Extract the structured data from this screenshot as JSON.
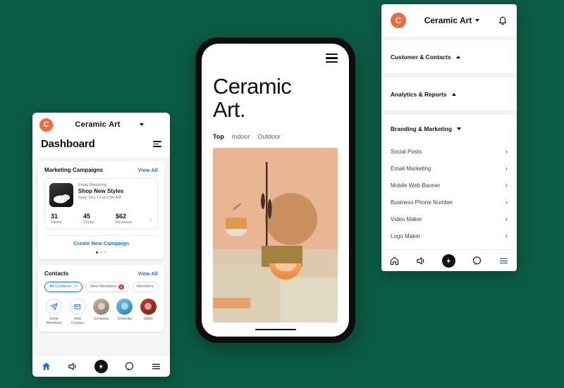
{
  "theme": {
    "background": "#0b5c46",
    "brand_orange": "#f2693c",
    "link_blue": "#1a73e8",
    "badge_red": "#e5342a",
    "dark": "#111111"
  },
  "left_phone": {
    "header": {
      "logo_letter": "C",
      "brand": "Ceramic Art",
      "chevron_icon": "chevron-down-icon"
    },
    "page_title": "Dashboard",
    "filter_icon": "list-filter-icon",
    "campaigns_card": {
      "title": "Marketing Campaigns",
      "view_all": "View All",
      "campaign": {
        "kind": "Email Marketing",
        "name": "Shop New Styles",
        "sent": "Sent: Dec 12 at 9:55 AM"
      },
      "stats": [
        {
          "value": "31",
          "label": "Views"
        },
        {
          "value": "45",
          "label": "Clicks"
        },
        {
          "value": "$62",
          "label": "Revenue"
        }
      ],
      "arrow": "›",
      "cta": "Create New Campaign",
      "dots": 3,
      "active_dot": 0
    },
    "contacts_card": {
      "title": "Contacts",
      "view_all": "View All",
      "chips": [
        {
          "label": "All Contacts",
          "count": "24",
          "active": true
        },
        {
          "label": "New Members",
          "badge": "2",
          "active": false
        },
        {
          "label": "Members",
          "active": false
        }
      ],
      "actions": [
        {
          "label": "Invite Members",
          "icon": "send-icon"
        },
        {
          "label": "Add Contact",
          "icon": "mail-add-icon"
        }
      ],
      "people": [
        {
          "name": "Jordanna"
        },
        {
          "name": "Chakrika"
        },
        {
          "name": "Gibby"
        }
      ]
    },
    "bottom_nav": [
      {
        "icon": "home-icon",
        "active": true
      },
      {
        "icon": "megaphone-icon",
        "active": false
      },
      {
        "icon": "lightning-bolt-icon",
        "active": false,
        "fab": true
      },
      {
        "icon": "chat-bubble-icon",
        "active": false
      },
      {
        "icon": "hamburger-menu-icon",
        "active": false
      }
    ]
  },
  "center_phone": {
    "menu_icon": "hamburger-menu-icon",
    "title_line1": "Ceramic",
    "title_line2": "Art.",
    "tabs": [
      {
        "label": "Top",
        "active": true
      },
      {
        "label": "Indoor",
        "active": false
      },
      {
        "label": "Outdoor",
        "active": false
      }
    ],
    "hero_image": "ceramic-still-life-photo",
    "home_indicator": "home-indicator-bar"
  },
  "right_panel": {
    "header": {
      "logo_letter": "C",
      "brand": "Ceramic Art",
      "chevron_icon": "chevron-down-icon",
      "bell_icon": "notification-bell-icon"
    },
    "sections": [
      {
        "label": "Customer & Contacts",
        "expanded": true
      },
      {
        "label": "Analytics & Reports",
        "expanded": true
      },
      {
        "label": "Branding & Marketing",
        "expanded": false
      }
    ],
    "menu_items": [
      {
        "label": "Social Posts"
      },
      {
        "label": "Email Marketing"
      },
      {
        "label": "Mobile Web Banner"
      },
      {
        "label": "Business Phone Number"
      },
      {
        "label": "Video Maker"
      },
      {
        "label": "Logo Maker"
      }
    ],
    "chevron_right": "›",
    "bottom_nav": [
      {
        "icon": "home-icon",
        "active": false
      },
      {
        "icon": "megaphone-icon",
        "active": false
      },
      {
        "icon": "lightning-bolt-icon",
        "active": false,
        "fab": true
      },
      {
        "icon": "chat-bubble-icon",
        "active": false
      },
      {
        "icon": "hamburger-menu-icon",
        "active": true
      }
    ]
  }
}
